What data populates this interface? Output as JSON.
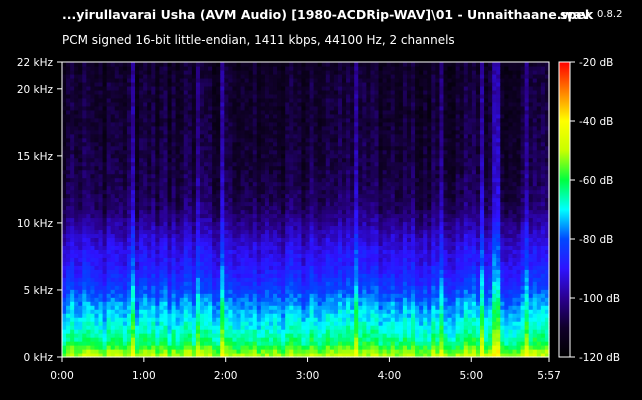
{
  "header": {
    "file_title": "...yirullavarai Usha (AVM Audio) [1980-ACDRip-WAV]\\01 - Unnaithaane.wav",
    "app_name": "spek",
    "app_version": "0.8.2",
    "stream_info": "PCM signed 16-bit little-endian, 1411 kbps, 44100 Hz, 2 channels"
  },
  "chart_data": {
    "type": "heatmap",
    "x_axis": {
      "ticks": [
        "0:00",
        "1:00",
        "2:00",
        "3:00",
        "4:00",
        "5:00",
        "5:57"
      ],
      "tick_seconds": [
        0,
        60,
        120,
        180,
        240,
        300,
        357
      ],
      "range_seconds": [
        0,
        357
      ]
    },
    "y_axis": {
      "ticks": [
        "0 kHz",
        "5 kHz",
        "10 kHz",
        "15 kHz",
        "20 kHz",
        "22 kHz"
      ],
      "tick_khz": [
        0,
        5,
        10,
        15,
        20,
        22
      ],
      "range_khz": [
        0,
        22
      ]
    },
    "colorbar": {
      "ticks": [
        "-20 dB",
        "-40 dB",
        "-60 dB",
        "-80 dB",
        "-100 dB",
        "-120 dB"
      ],
      "tick_db": [
        -20,
        -40,
        -60,
        -80,
        -100,
        -120
      ],
      "range_db": [
        -120,
        -20
      ]
    },
    "colormap": [
      "#000000",
      "#10002a",
      "#2a0090",
      "#2e13ff",
      "#0048ff",
      "#00ffff",
      "#00ff40",
      "#c8ff00",
      "#ffff00",
      "#ff8000",
      "#ff0000"
    ],
    "profile": {
      "khz": [
        0,
        0.5,
        1,
        2,
        3,
        4,
        5,
        6,
        7,
        8,
        9,
        10,
        11,
        12,
        14,
        16,
        18,
        20,
        21.5,
        22
      ],
      "db": [
        -50,
        -55,
        -62,
        -68,
        -72,
        -76,
        -82,
        -86,
        -90,
        -92,
        -96,
        -100,
        -104,
        -106,
        -108,
        -109,
        -110,
        -110,
        -111,
        -112
      ]
    }
  }
}
